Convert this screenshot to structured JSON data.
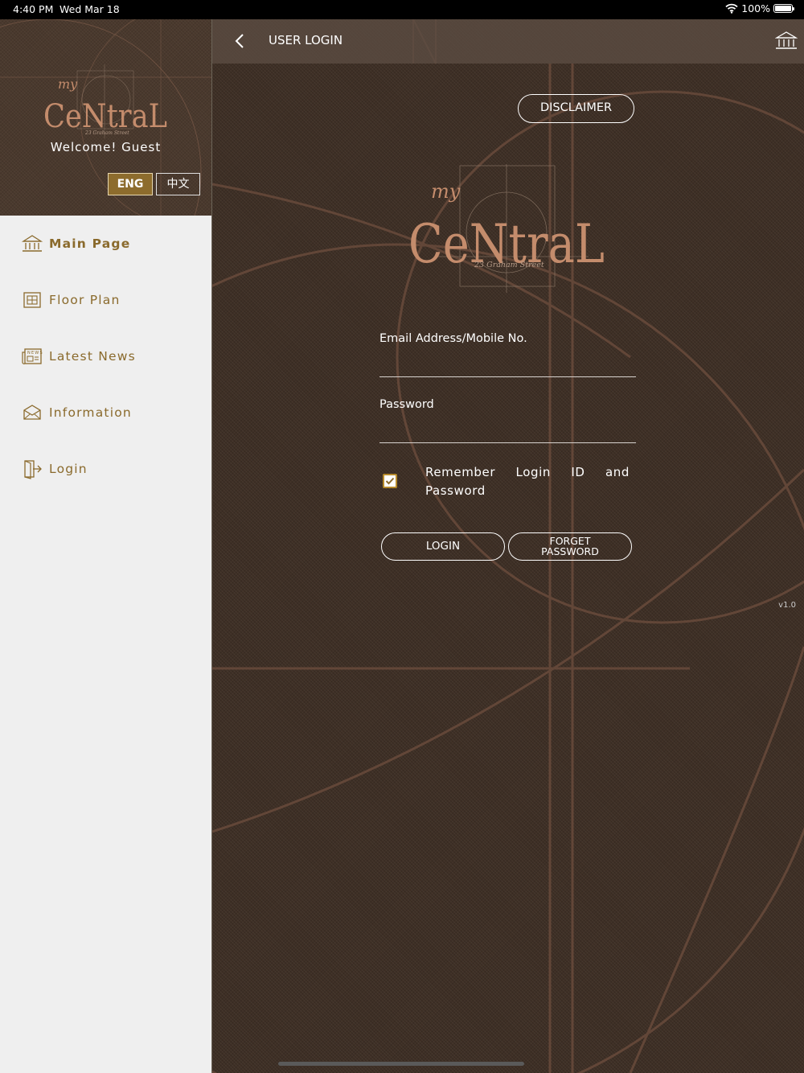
{
  "status_bar": {
    "time": "4:40 PM",
    "date": "Wed Mar 18",
    "battery": "100%"
  },
  "sidebar": {
    "logo": {
      "prefix": "my",
      "main": "CeNtraL",
      "sub": "23 Graham Street"
    },
    "welcome": "Welcome! Guest",
    "languages": [
      "ENG",
      "中文"
    ],
    "active_language": "ENG",
    "items": [
      {
        "label": "Main Page",
        "icon": "building-icon"
      },
      {
        "label": "Floor Plan",
        "icon": "floor-plan-icon"
      },
      {
        "label": "Latest News",
        "icon": "newspaper-icon"
      },
      {
        "label": "Information",
        "icon": "mail-info-icon"
      },
      {
        "label": "Login",
        "icon": "door-login-icon"
      }
    ]
  },
  "header": {
    "title": "USER LOGIN"
  },
  "login": {
    "disclaimer": "DISCLAIMER",
    "email_label": "Email Address/Mobile No.",
    "password_label": "Password",
    "remember_label": "Remember Login ID and Password",
    "remember_checked": true,
    "login_button": "LOGIN",
    "forget_button_line1": "FORGET",
    "forget_button_line2": "PASSWORD",
    "version": "v1.0"
  },
  "colors": {
    "accent_gold": "#8d6c2d",
    "background_brown": "#3e2f25",
    "sidebar_bg": "#efefef",
    "logo_copper": "#c48c6c"
  }
}
